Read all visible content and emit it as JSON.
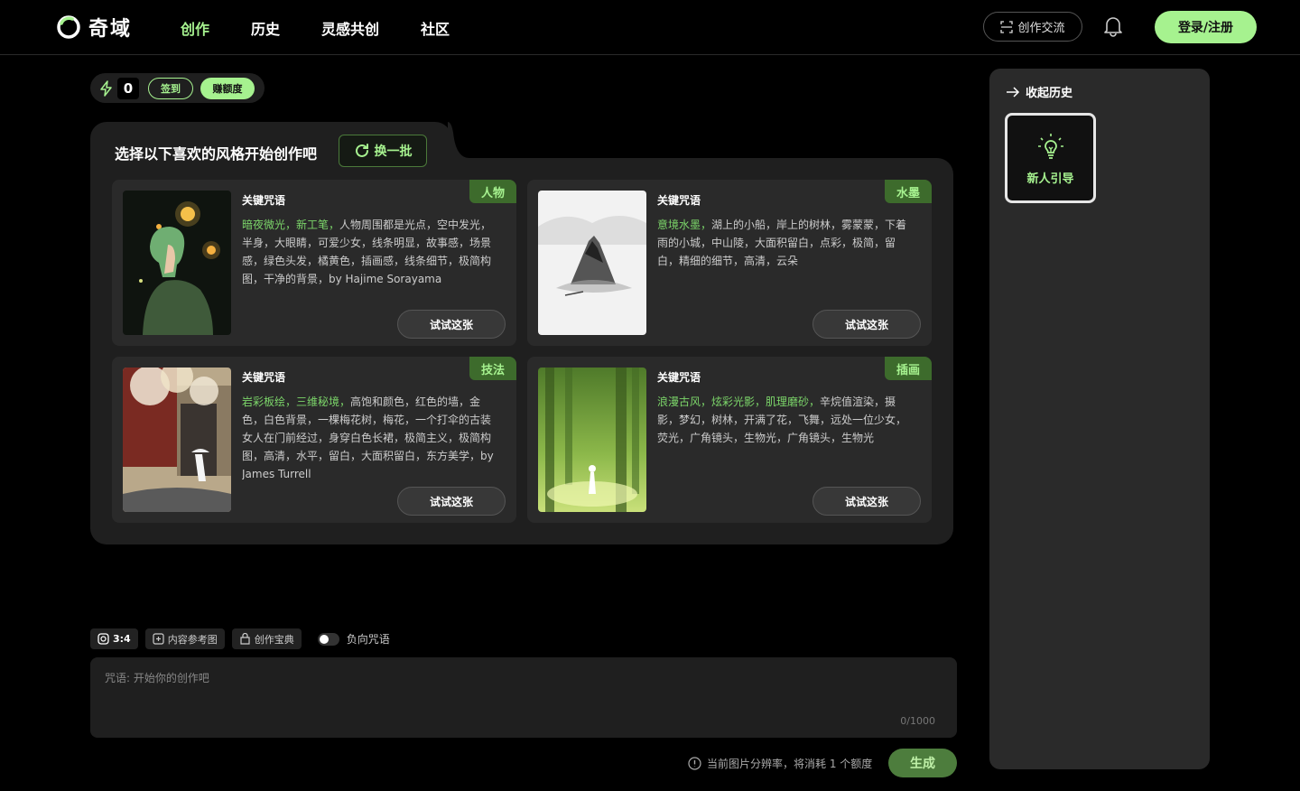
{
  "header": {
    "logo_text": "奇域",
    "nav": [
      "创作",
      "历史",
      "灵感共创",
      "社区"
    ],
    "exchange_label": "创作交流",
    "login_label": "登录/注册"
  },
  "credits": {
    "count": "0",
    "signin_label": "签到",
    "earn_label": "赚额度"
  },
  "style_panel": {
    "title": "选择以下喜欢的风格开始创作吧",
    "refresh_label": "换一批",
    "keyword_label": "关键咒语",
    "try_label": "试试这张",
    "cards": [
      {
        "tag": "人物",
        "highlight": "暗夜微光，新工笔，",
        "text": "人物周围都是光点，空中发光，半身，大眼睛，可爱少女，线条明显，故事感，场景感，绿色头发，橘黄色，插画感，线条细节，极简构图，干净的背景，by Hajime Sorayama"
      },
      {
        "tag": "水墨",
        "highlight": "意境水墨，",
        "text": "湖上的小船，岸上的树林，雾蒙蒙，下着雨的小城，中山陵，大面积留白，点彩，极简，留白，精细的细节，高清，云朵"
      },
      {
        "tag": "技法",
        "highlight": "岩彩板绘，三维秘境，",
        "text": "高饱和颜色，红色的墙，金色，白色背景，一棵梅花树，梅花，一个打伞的古装女人在门前经过，身穿白色长裙，极简主义，极简构图，高清，水平，留白，大面积留白，东方美学，by James Turrell"
      },
      {
        "tag": "插画",
        "highlight": "浪漫古风，炫彩光影，肌理磨砂，",
        "text": "辛烷值渲染，摄影，梦幻，树林，开满了花，飞舞，远处一位少女，荧光，广角镜头，生物光，广角镜头，生物光"
      }
    ]
  },
  "toolbar": {
    "ratio_label": "3:4",
    "reference_label": "内容参考图",
    "guide_book_label": "创作宝典",
    "negative_label": "负向咒语"
  },
  "prompt": {
    "placeholder": "咒语: 开始你的创作吧",
    "counter": "0/1000"
  },
  "footer": {
    "note": "当前图片分辨率，将消耗 1 个额度",
    "generate_label": "生成"
  },
  "history": {
    "collapse_label": "收起历史",
    "guide_label": "新人引导"
  },
  "colors": {
    "accent": "#a6f28f",
    "tag_bg": "#3d6b2c",
    "panel_bg": "#1f1f1f",
    "card_bg": "#2a2a2a"
  }
}
